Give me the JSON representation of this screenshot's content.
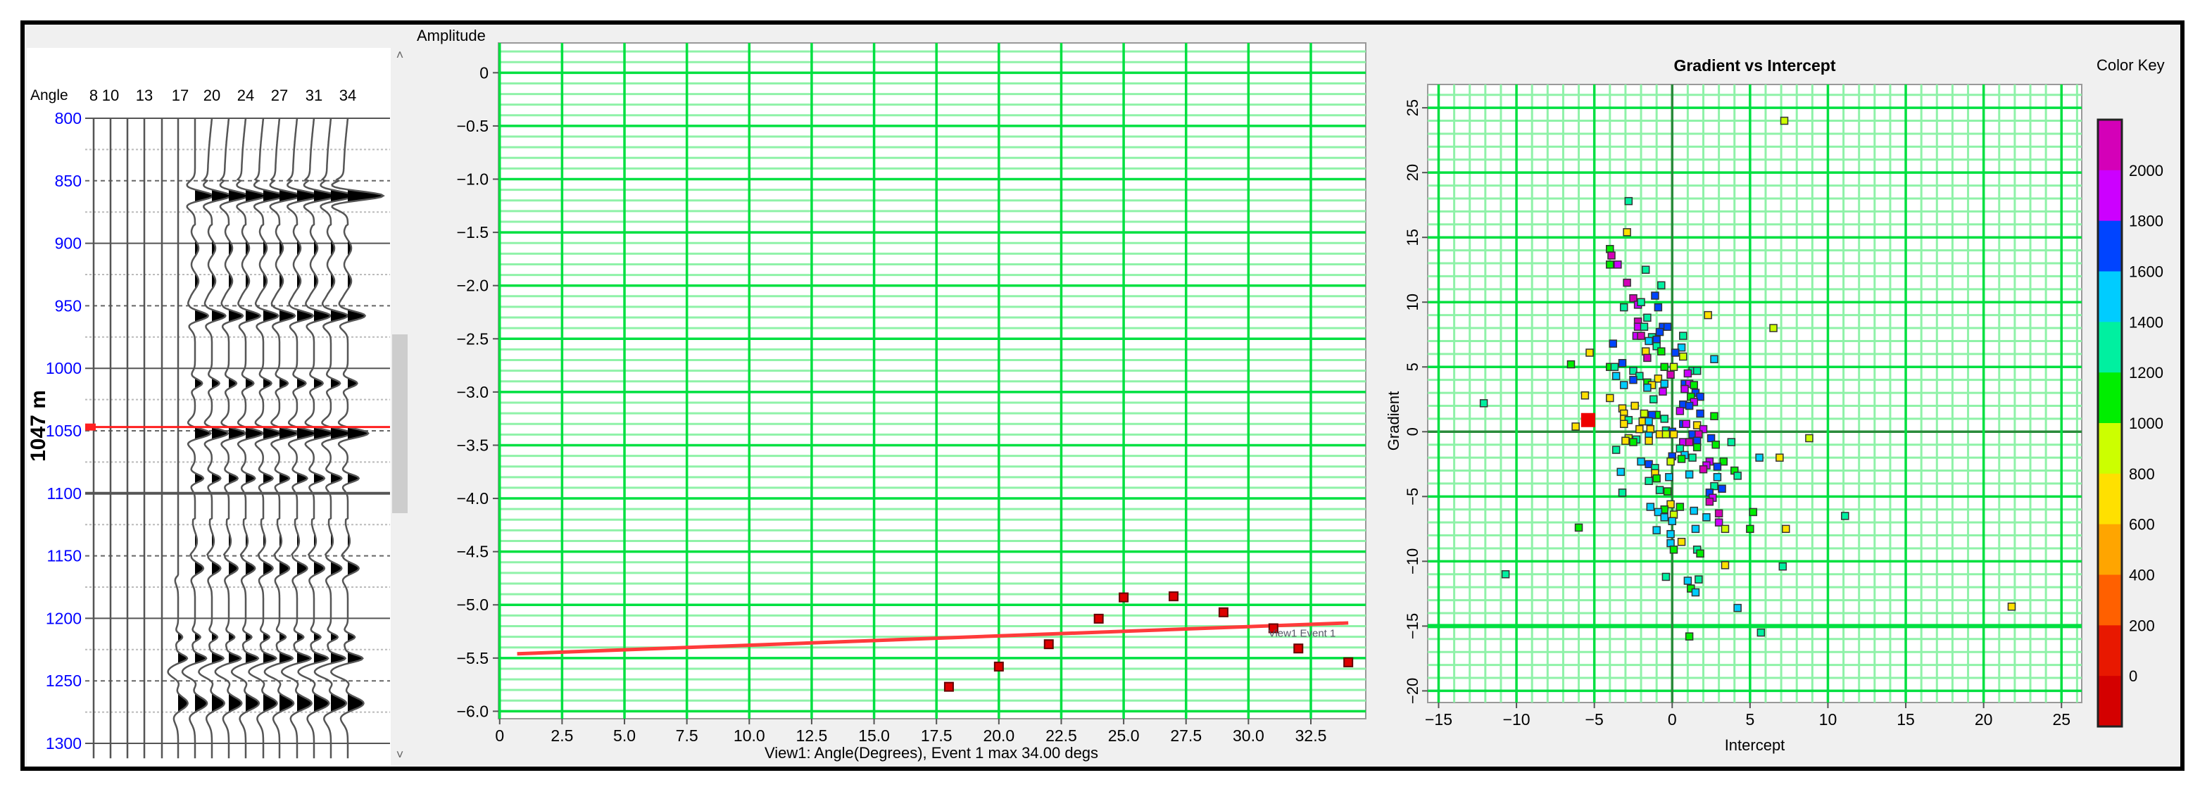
{
  "seismic_panel": {
    "angle_label": "Angle",
    "angle_labels": [
      "8",
      "10",
      "13",
      "17",
      "20",
      "24",
      "27",
      "31",
      "34"
    ],
    "depth_labels": [
      "800",
      "850",
      "900",
      "950",
      "1000",
      "1050",
      "1100",
      "1150",
      "1200",
      "1250",
      "1300"
    ],
    "depth_marker_label": "1047 m",
    "depth_marker_value": 1047,
    "depth_label_color": "#0000ff",
    "marker_color": "#ff2020"
  },
  "chart_data": [
    {
      "type": "scatter",
      "title": "",
      "ylabel": "Amplitude",
      "xlabel": "View1: Angle(Degrees), Event 1 max 34.00 degs",
      "xlim": [
        -0.05,
        34.7
      ],
      "ylim": [
        -6.07,
        0.28
      ],
      "xticks": [
        0,
        2.5,
        5,
        7.5,
        10,
        12.5,
        15,
        17.5,
        20,
        22.5,
        25,
        27.5,
        30,
        32.5
      ],
      "xtick_labels": [
        "0",
        "2.5",
        "5.0",
        "7.5",
        "10.0",
        "12.5",
        "15.0",
        "17.5",
        "20.0",
        "22.5",
        "25.0",
        "27.5",
        "30.0",
        "32.5"
      ],
      "yticks": [
        0,
        -0.5,
        -1,
        -1.5,
        -2,
        -2.5,
        -3,
        -3.5,
        -4,
        -4.5,
        -5,
        -5.5,
        -6
      ],
      "ytick_labels": [
        "0",
        "−0.5",
        "−1.0",
        "−1.5",
        "−2.0",
        "−2.5",
        "−3.0",
        "−3.5",
        "−4.0",
        "−4.5",
        "−5.0",
        "−5.5",
        "−6.0"
      ],
      "grid": true,
      "points": [
        [
          18,
          -5.77
        ],
        [
          20,
          -5.58
        ],
        [
          22,
          -5.37
        ],
        [
          24,
          -5.13
        ],
        [
          25,
          -4.93
        ],
        [
          27,
          -4.92
        ],
        [
          29,
          -5.07
        ],
        [
          31,
          -5.22
        ],
        [
          32,
          -5.41
        ],
        [
          34,
          -5.54
        ]
      ],
      "fit_line": [
        [
          0.7,
          -5.46
        ],
        [
          34,
          -5.17
        ]
      ],
      "annotation": {
        "text": "View1 Event 1",
        "x": 30.8,
        "y": -5.3
      },
      "point_color": "#dd0000",
      "line_color": "#ff3b3b",
      "grid_color": "#00e040"
    },
    {
      "type": "scatter",
      "title": "Gradient vs Intercept",
      "xlabel": "Intercept",
      "ylabel": "Gradient",
      "xlim": [
        -15.7,
        26.3
      ],
      "ylim": [
        -20.9,
        26.8
      ],
      "xticks": [
        -15,
        -10,
        -5,
        0,
        5,
        10,
        15,
        20,
        25
      ],
      "xtick_labels": [
        "−15",
        "−10",
        "−5",
        "0",
        "5",
        "10",
        "15",
        "20",
        "25"
      ],
      "yticks": [
        -20,
        -15,
        -10,
        -5,
        0,
        5,
        10,
        15,
        20,
        25
      ],
      "ytick_labels": [
        "−20",
        "−15",
        "−10",
        "−5",
        "0",
        "5",
        "10",
        "15",
        "20",
        "25"
      ],
      "grid": true,
      "selected_point": [
        -5.4,
        0.9
      ],
      "selected_color": "#ee0000",
      "points": [
        [
          7.2,
          24.0,
          900
        ],
        [
          -2.8,
          17.8,
          1300
        ],
        [
          -2.9,
          15.4,
          700
        ],
        [
          -4.0,
          14.1,
          1100
        ],
        [
          -3.9,
          13.6,
          2000
        ],
        [
          -4.0,
          12.9,
          1100
        ],
        [
          -3.5,
          12.9,
          1900
        ],
        [
          -1.7,
          12.5,
          1300
        ],
        [
          -2.9,
          11.5,
          2000
        ],
        [
          -0.7,
          11.3,
          1300
        ],
        [
          -1.1,
          10.5,
          1700
        ],
        [
          -2.5,
          10.3,
          2000
        ],
        [
          -3.1,
          9.6,
          1300
        ],
        [
          -2.2,
          9.8,
          1900
        ],
        [
          -2.0,
          10.0,
          1300
        ],
        [
          -0.9,
          9.6,
          1700
        ],
        [
          2.3,
          9.0,
          700
        ],
        [
          -1.6,
          8.8,
          1300
        ],
        [
          -2.2,
          8.5,
          2000
        ],
        [
          -2.2,
          8.1,
          1900
        ],
        [
          -0.6,
          8.1,
          1700
        ],
        [
          -0.3,
          8.1,
          1700
        ],
        [
          6.5,
          8.0,
          900
        ],
        [
          -1.8,
          8.1,
          1300
        ],
        [
          -0.8,
          7.7,
          1700
        ],
        [
          -2.3,
          7.4,
          1900
        ],
        [
          -2.0,
          7.4,
          2000
        ],
        [
          -1.3,
          7.3,
          1300
        ],
        [
          -1.0,
          7.1,
          1700
        ],
        [
          0.7,
          7.4,
          1300
        ],
        [
          -1.5,
          7.0,
          1500
        ],
        [
          -3.8,
          6.8,
          1700
        ],
        [
          -1.0,
          6.6,
          1300
        ],
        [
          0.6,
          6.5,
          1500
        ],
        [
          -5.3,
          6.1,
          700
        ],
        [
          -1.7,
          6.2,
          700
        ],
        [
          -0.7,
          6.2,
          1100
        ],
        [
          0.2,
          6.1,
          1700
        ],
        [
          -1.6,
          5.7,
          2000
        ],
        [
          0.7,
          5.8,
          900
        ],
        [
          2.7,
          5.6,
          1500
        ],
        [
          -6.5,
          5.2,
          1100
        ],
        [
          -3.2,
          5.3,
          1700
        ],
        [
          -4.0,
          5.0,
          1100
        ],
        [
          -3.7,
          5.0,
          1300
        ],
        [
          -0.5,
          5.0,
          1100
        ],
        [
          0.1,
          5.0,
          900
        ],
        [
          -2.5,
          4.7,
          1300
        ],
        [
          1.3,
          4.7,
          1300
        ],
        [
          1.6,
          4.7,
          1300
        ],
        [
          -3.6,
          4.3,
          1500
        ],
        [
          -2.1,
          4.3,
          1300
        ],
        [
          -0.1,
          4.4,
          2000
        ],
        [
          1.0,
          4.5,
          1900
        ],
        [
          -2.5,
          4.0,
          1700
        ],
        [
          -0.9,
          4.1,
          700
        ],
        [
          -3.1,
          3.6,
          1500
        ],
        [
          -1.6,
          3.8,
          1100
        ],
        [
          -1.3,
          3.6,
          700
        ],
        [
          -0.5,
          3.7,
          1500
        ],
        [
          0.8,
          3.7,
          1700
        ],
        [
          1.1,
          3.7,
          1900
        ],
        [
          1.4,
          3.6,
          1100
        ],
        [
          -1.6,
          3.4,
          1500
        ],
        [
          -0.6,
          3.1,
          1900
        ],
        [
          0.8,
          3.3,
          1900
        ],
        [
          1.5,
          3.0,
          1700
        ],
        [
          1.8,
          2.7,
          1700
        ],
        [
          1.2,
          2.7,
          1100
        ],
        [
          -4.0,
          2.6,
          700
        ],
        [
          -1.2,
          2.5,
          1300
        ],
        [
          0.7,
          2.1,
          1700
        ],
        [
          1.4,
          2.3,
          1900
        ],
        [
          -12.1,
          2.2,
          1300
        ],
        [
          -5.6,
          2.8,
          700
        ],
        [
          -3.2,
          1.8,
          700
        ],
        [
          -2.4,
          2.0,
          700
        ],
        [
          0.5,
          1.6,
          1900
        ],
        [
          1.1,
          2.0,
          1700
        ],
        [
          -3.1,
          1.4,
          700
        ],
        [
          -1.8,
          1.4,
          900
        ],
        [
          -1.0,
          1.3,
          1100
        ],
        [
          -1.3,
          1.3,
          1700
        ],
        [
          1.8,
          1.4,
          1700
        ],
        [
          2.7,
          1.2,
          1100
        ],
        [
          -3.1,
          1.0,
          700
        ],
        [
          -2.8,
          0.9,
          1300
        ],
        [
          -0.5,
          1.0,
          1300
        ],
        [
          -1.9,
          0.8,
          700
        ],
        [
          -1.5,
          0.8,
          1500
        ],
        [
          0.7,
          0.6,
          1700
        ],
        [
          0.9,
          0.6,
          1900
        ],
        [
          -3.1,
          0.6,
          700
        ],
        [
          -6.2,
          0.4,
          700
        ],
        [
          -2.1,
          0.2,
          700
        ],
        [
          -1.4,
          0.2,
          700
        ],
        [
          -0.4,
          0.1,
          1300
        ],
        [
          0.0,
          0.0,
          1700
        ],
        [
          1.6,
          0.5,
          700
        ],
        [
          2.0,
          0.2,
          1900
        ],
        [
          -0.8,
          -0.2,
          700
        ],
        [
          -0.4,
          -0.2,
          900
        ],
        [
          0.1,
          -0.2,
          700
        ],
        [
          1.3,
          -0.2,
          1700
        ],
        [
          1.7,
          -0.2,
          2000
        ],
        [
          -1.5,
          -0.3,
          1500
        ],
        [
          2.5,
          -0.5,
          1700
        ],
        [
          8.8,
          -0.5,
          900
        ],
        [
          -2.8,
          -0.5,
          900
        ],
        [
          -2.3,
          -0.6,
          1300
        ],
        [
          -3.0,
          -0.7,
          700
        ],
        [
          -2.5,
          -0.8,
          1100
        ],
        [
          -1.5,
          -0.7,
          700
        ],
        [
          0.7,
          -0.8,
          1900
        ],
        [
          1.1,
          -0.8,
          2000
        ],
        [
          1.6,
          -0.7,
          1700
        ],
        [
          3.8,
          -0.8,
          1300
        ],
        [
          2.8,
          -1.0,
          1100
        ],
        [
          1.6,
          -1.2,
          1100
        ],
        [
          0.5,
          -1.3,
          1300
        ],
        [
          -3.6,
          -1.4,
          1300
        ],
        [
          0.8,
          -1.8,
          1500
        ],
        [
          5.6,
          -2.0,
          1500
        ],
        [
          6.9,
          -2.0,
          700
        ],
        [
          0.0,
          -1.9,
          1700
        ],
        [
          0.6,
          -2.1,
          1100
        ],
        [
          1.3,
          -2.0,
          1300
        ],
        [
          -2.0,
          -2.3,
          1500
        ],
        [
          -0.1,
          -2.3,
          900
        ],
        [
          3.3,
          -2.3,
          1100
        ],
        [
          2.4,
          -2.3,
          1900
        ],
        [
          -1.5,
          -2.5,
          1700
        ],
        [
          2.2,
          -2.6,
          1900
        ],
        [
          2.9,
          -2.7,
          1700
        ],
        [
          -1.1,
          -2.8,
          1300
        ],
        [
          2.0,
          -2.9,
          2000
        ],
        [
          4.0,
          -3.0,
          1100
        ],
        [
          -3.3,
          -3.1,
          1500
        ],
        [
          -1.1,
          -3.2,
          700
        ],
        [
          1.1,
          -3.3,
          1500
        ],
        [
          4.2,
          -3.4,
          1300
        ],
        [
          2.9,
          -3.5,
          1500
        ],
        [
          -1.5,
          -3.8,
          1300
        ],
        [
          -1.0,
          -3.6,
          1100
        ],
        [
          -0.2,
          -3.5,
          1500
        ],
        [
          2.7,
          -4.2,
          1300
        ],
        [
          3.2,
          -4.4,
          1700
        ],
        [
          -0.8,
          -4.5,
          1300
        ],
        [
          -0.3,
          -4.6,
          1100
        ],
        [
          -3.2,
          -4.7,
          1300
        ],
        [
          2.4,
          -4.7,
          1700
        ],
        [
          2.6,
          -5.1,
          1900
        ],
        [
          2.4,
          -5.4,
          2000
        ],
        [
          -0.1,
          -5.6,
          700
        ],
        [
          -1.4,
          -5.8,
          1500
        ],
        [
          0.5,
          -5.8,
          1100
        ],
        [
          -0.5,
          -6.0,
          1100
        ],
        [
          -0.9,
          -6.2,
          1500
        ],
        [
          1.4,
          -6.1,
          1500
        ],
        [
          5.2,
          -6.2,
          1100
        ],
        [
          3.0,
          -6.3,
          2000
        ],
        [
          0.1,
          -6.4,
          900
        ],
        [
          -0.5,
          -6.6,
          1500
        ],
        [
          2.2,
          -6.6,
          1500
        ],
        [
          11.1,
          -6.5,
          1300
        ],
        [
          0.0,
          -6.9,
          1500
        ],
        [
          3.0,
          -7.0,
          1900
        ],
        [
          -6.0,
          -7.4,
          1100
        ],
        [
          1.5,
          -7.5,
          1500
        ],
        [
          3.4,
          -7.5,
          900
        ],
        [
          5.0,
          -7.5,
          1100
        ],
        [
          7.3,
          -7.5,
          700
        ],
        [
          -1.0,
          -7.6,
          1500
        ],
        [
          -0.1,
          -7.9,
          1500
        ],
        [
          0.6,
          -8.5,
          700
        ],
        [
          -0.1,
          -8.6,
          1500
        ],
        [
          1.6,
          -9.1,
          1300
        ],
        [
          0.1,
          -9.1,
          1100
        ],
        [
          1.8,
          -9.4,
          1100
        ],
        [
          3.4,
          -10.3,
          700
        ],
        [
          7.1,
          -10.4,
          1300
        ],
        [
          -10.7,
          -11.0,
          1300
        ],
        [
          -0.4,
          -11.2,
          1300
        ],
        [
          1.0,
          -11.5,
          1500
        ],
        [
          1.7,
          -11.4,
          1300
        ],
        [
          1.2,
          -12.1,
          1100
        ],
        [
          1.5,
          -12.4,
          1500
        ],
        [
          21.8,
          -13.5,
          700
        ],
        [
          4.2,
          -13.6,
          1500
        ],
        [
          5.7,
          -15.5,
          1300
        ],
        [
          1.1,
          -15.8,
          1100
        ]
      ],
      "color_key": {
        "title": "Color Key",
        "labels": [
          "2000",
          "1800",
          "1600",
          "1400",
          "1200",
          "1000",
          "800",
          "600",
          "400",
          "200",
          "0"
        ],
        "colors": [
          "#d400b8",
          "#cc00ff",
          "#0044ff",
          "#00ccff",
          "#00f0a0",
          "#00ee00",
          "#ccff00",
          "#ffe000",
          "#ffa500",
          "#ff6000",
          "#e81800",
          "#d40000"
        ]
      }
    }
  ]
}
